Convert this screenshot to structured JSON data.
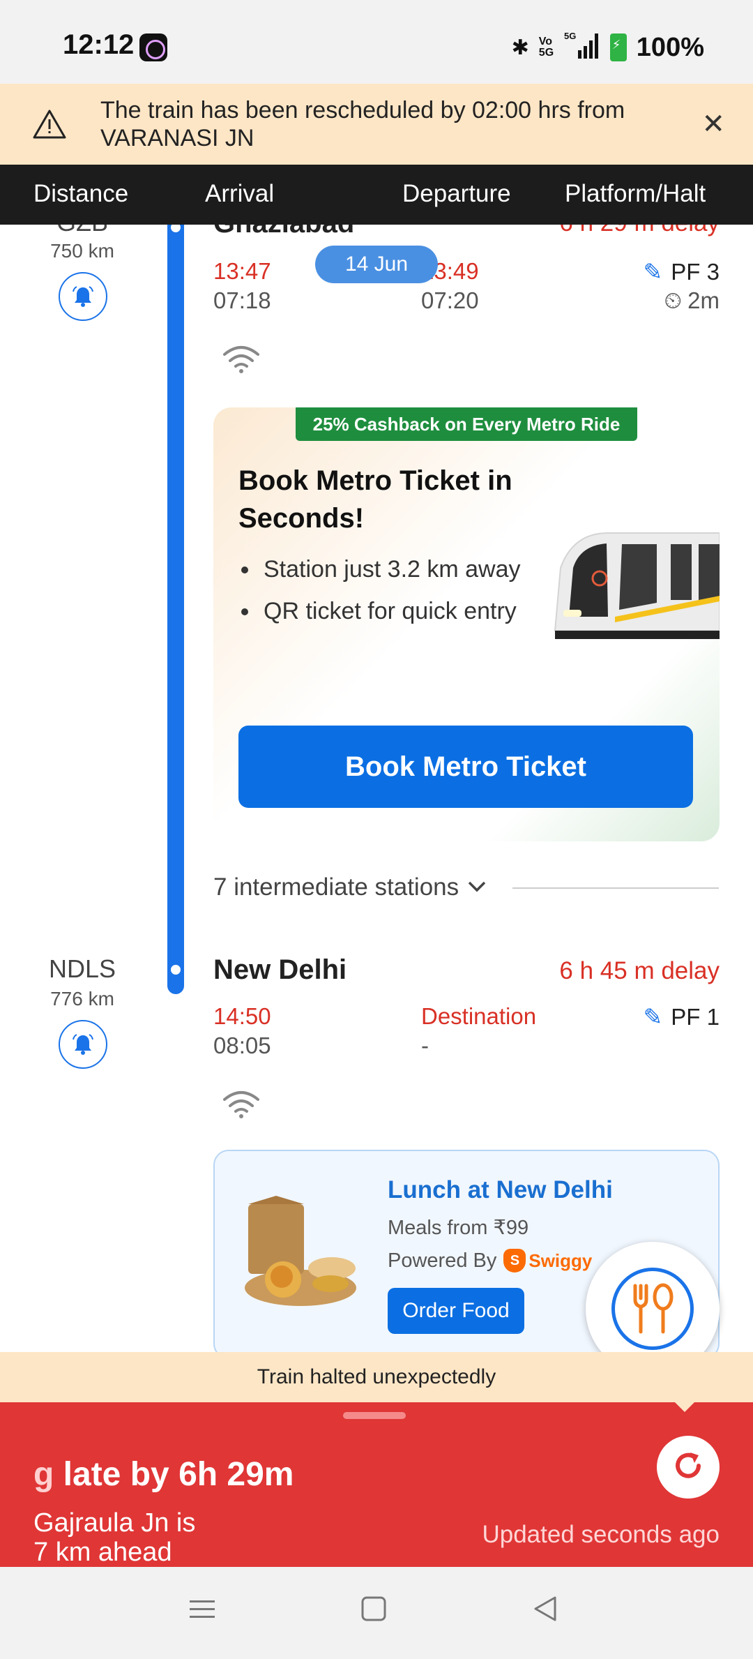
{
  "status_bar": {
    "time": "12:12",
    "network": "5G",
    "volte": "Vo 5G",
    "battery": "100%"
  },
  "banner": {
    "message": "The train has been rescheduled by 02:00 hrs from VARANASI JN",
    "icon": "warning-icon",
    "close_icon": "close-icon"
  },
  "columns": {
    "distance": "Distance",
    "arrival": "Arrival",
    "departure": "Departure",
    "platform": "Platform/Halt"
  },
  "stations": [
    {
      "code": "GZB",
      "km": "750 km",
      "name": "Ghaziabad",
      "delay": "6 h 29 m delay",
      "arrival_actual": "13:47",
      "arrival_sched": "07:18",
      "departure_actual": "13:49",
      "departure_sched": "07:20",
      "date": "14 Jun",
      "platform": "PF 3",
      "halt": "2m"
    },
    {
      "code": "NDLS",
      "km": "776 km",
      "name": "New Delhi",
      "delay": "6 h 45 m delay",
      "arrival_actual": "14:50",
      "arrival_sched": "08:05",
      "departure_label": "Destination",
      "departure_sched": "-",
      "platform": "PF 1"
    }
  ],
  "metro_ad": {
    "chip": "25% Cashback on Every Metro Ride",
    "title": "Book Metro Ticket in Seconds!",
    "bullets": [
      "Station just 3.2 km away",
      "QR ticket for quick entry"
    ],
    "button": "Book Metro Ticket"
  },
  "intermediate": {
    "label": "7 intermediate stations"
  },
  "food_ad": {
    "title": "Lunch at New Delhi",
    "subtitle": "Meals from ₹99",
    "powered_by": "Powered By",
    "brand": "Swiggy",
    "button": "Order Food"
  },
  "halted": "Train halted unexpectedly",
  "live_status": {
    "late_prefix": "g",
    "late": " late by 6h 29m",
    "ahead_line1": "Gajraula Jn is",
    "ahead_line2": "7 km ahead",
    "updated": "Updated seconds  ago"
  },
  "colors": {
    "accent": "#1a73e8",
    "delay_red": "#d93025",
    "banner_bg": "#fde6c6",
    "status_red": "#e03636",
    "chip_green": "#1e8e3e"
  }
}
